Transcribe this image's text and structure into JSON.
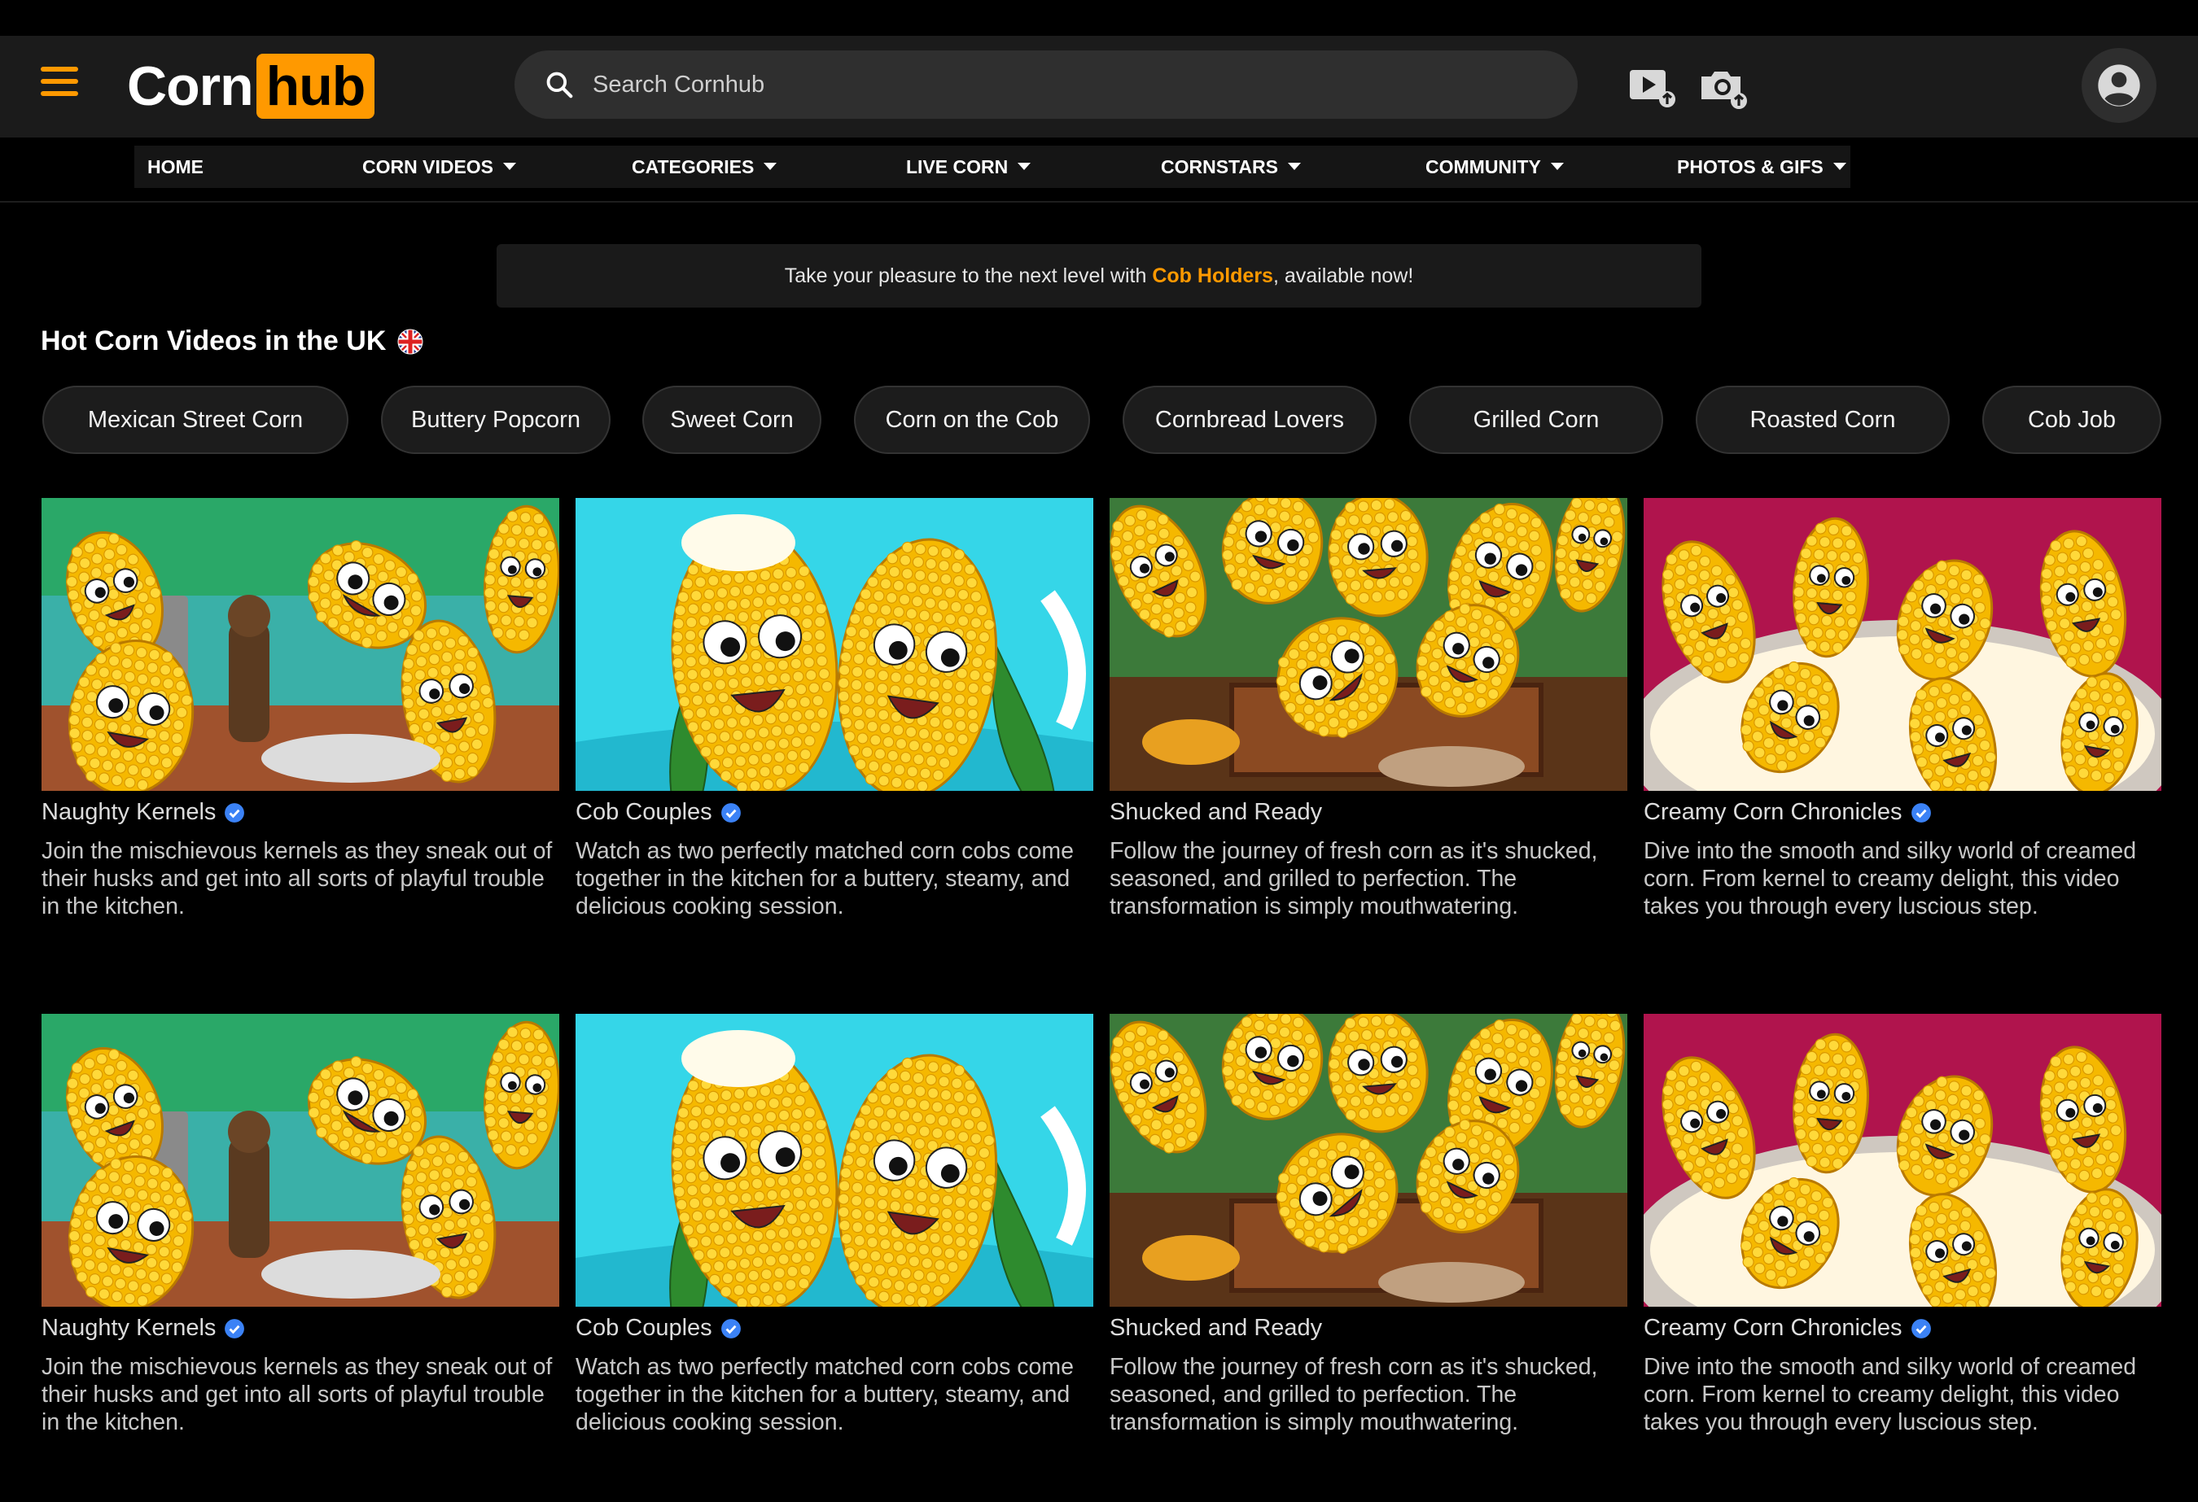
{
  "header": {
    "logo_left": "Corn",
    "logo_right": "hub",
    "search_placeholder": "Search Cornhub"
  },
  "colors": {
    "accent": "#ff9900",
    "background": "#000000",
    "header": "#1b1b1b",
    "verified": "#3b82f6"
  },
  "icons": {
    "menu": "hamburger-menu-icon",
    "search": "search-icon",
    "upload_video": "video-upload-icon",
    "upload_photo": "camera-upload-icon",
    "account": "user-avatar-icon",
    "flag": "uk-flag-icon",
    "verified": "verified-badge-icon"
  },
  "nav": {
    "items": [
      {
        "label": "HOME"
      },
      {
        "label": "CORN VIDEOS"
      },
      {
        "label": "CATEGORIES"
      },
      {
        "label": "LIVE CORN"
      },
      {
        "label": "CORNSTARS"
      },
      {
        "label": "COMMUNITY"
      },
      {
        "label": "PHOTOS & GIFS"
      }
    ]
  },
  "banner": {
    "prefix": "Take your pleasure to the next level with ",
    "link": "Cob Holders",
    "suffix": ", available now!"
  },
  "section": {
    "title": "Hot Corn Videos in the UK"
  },
  "categories": [
    "Mexican Street Corn",
    "Buttery Popcorn",
    "Sweet Corn",
    "Corn on the Cob",
    "Cornbread Lovers",
    "Grilled Corn",
    "Roasted Corn",
    "Cob Job"
  ],
  "videos": [
    {
      "title": "Naughty Kernels",
      "verified": true,
      "description": "Join the mischievous kernels as they sneak out of their husks and get into all sorts of playful trouble in the kitchen."
    },
    {
      "title": "Cob Couples",
      "verified": true,
      "description": "Watch as two perfectly matched corn cobs come together in the kitchen for a buttery, steamy, and delicious cooking session."
    },
    {
      "title": "Shucked and Ready",
      "verified": false,
      "description": "Follow the journey of fresh corn as it's shucked, seasoned, and grilled to perfection. The transformation is simply mouthwatering."
    },
    {
      "title": "Creamy Corn Chronicles",
      "verified": true,
      "description": "Dive into the smooth and silky world of creamed corn. From kernel to creamy delight, this video takes you through every luscious step."
    },
    {
      "title": "Naughty Kernels",
      "verified": true,
      "description": "Join the mischievous kernels as they sneak out of their husks and get into all sorts of playful trouble in the kitchen."
    },
    {
      "title": "Cob Couples",
      "verified": true,
      "description": "Watch as two perfectly matched corn cobs come together in the kitchen for a buttery, steamy, and delicious cooking session."
    },
    {
      "title": "Shucked and Ready",
      "verified": false,
      "description": "Follow the journey of fresh corn as it's shucked, seasoned, and grilled to perfection. The transformation is simply mouthwatering."
    },
    {
      "title": "Creamy Corn Chronicles",
      "verified": true,
      "description": "Dive into the smooth and silky world of creamed corn. From kernel to creamy delight, this video takes you through every luscious step."
    }
  ]
}
